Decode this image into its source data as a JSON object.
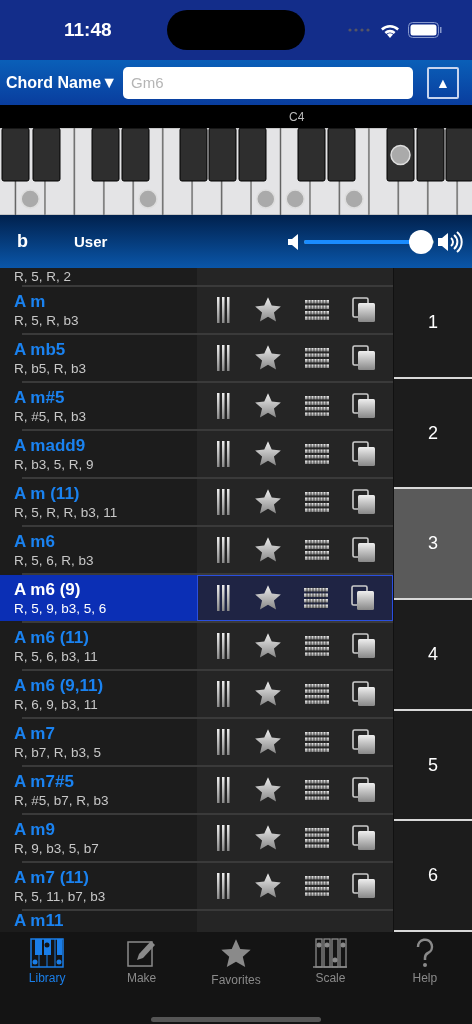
{
  "status_bar": {
    "time": "11:48"
  },
  "header": {
    "mode_button": "Chord Name▼",
    "search": {
      "placeholder": "Gm6"
    },
    "up_button": "▲"
  },
  "keyboard": {
    "octave_label": "C4",
    "white_keys": [
      {
        "marked": false
      },
      {
        "marked": true
      },
      {
        "marked": false
      },
      {
        "marked": false
      },
      {
        "marked": false
      },
      {
        "marked": true
      },
      {
        "marked": false
      },
      {
        "marked": false
      },
      {
        "marked": false
      },
      {
        "marked": true
      },
      {
        "marked": true
      },
      {
        "marked": false
      },
      {
        "marked": true
      },
      {
        "marked": false
      },
      {
        "marked": false
      },
      {
        "marked": false
      },
      {
        "marked": false
      }
    ],
    "black_keys": [
      {
        "marked": false
      },
      {
        "marked": false
      },
      {
        "marked": false
      },
      {
        "marked": false
      },
      {
        "marked": false
      },
      {
        "marked": false
      },
      {
        "marked": false
      },
      {
        "marked": false
      },
      {
        "marked": false
      },
      {
        "marked": true
      },
      {
        "marked": false
      },
      {
        "marked": false
      }
    ]
  },
  "controls": {
    "accidental": "b",
    "sound": "User",
    "volume": {
      "level": 0.9
    }
  },
  "chords": [
    {
      "notes": "R, 5, R, 2",
      "selected": false
    },
    {
      "name": "A m",
      "notes": "R, 5, R, b3",
      "selected": false
    },
    {
      "name": "A mb5",
      "notes": "R, b5, R, b3",
      "selected": false
    },
    {
      "name": "A m#5",
      "notes": "R, #5, R, b3",
      "selected": false
    },
    {
      "name": "A madd9",
      "notes": "R, b3, 5, R, 9",
      "selected": false
    },
    {
      "name": "A m (11)",
      "notes": "R, 5, R, R, b3, 11",
      "selected": false
    },
    {
      "name": "A m6",
      "notes": "R, 5, 6, R, b3",
      "selected": false
    },
    {
      "name": "A m6 (9)",
      "notes": "R, 5, 9, b3, 5, 6",
      "selected": true
    },
    {
      "name": "A m6 (11)",
      "notes": "R, 5, 6, b3, 11",
      "selected": false
    },
    {
      "name": "A m6 (9,11)",
      "notes": "R, 6, 9, b3, 11",
      "selected": false
    },
    {
      "name": "A m7",
      "notes": "R, b7, R, b3, 5",
      "selected": false
    },
    {
      "name": "A m7#5",
      "notes": "R, #5, b7, R, b3",
      "selected": false
    },
    {
      "name": "A m9",
      "notes": "R, 9, b3, 5, b7",
      "selected": false
    },
    {
      "name": "A m7 (11)",
      "notes": "R, 5, 11, b7, b3",
      "selected": false
    },
    {
      "name": "A m11",
      "selected": false
    }
  ],
  "index": [
    {
      "label": "1",
      "selected": false
    },
    {
      "label": "2",
      "selected": false
    },
    {
      "label": "3",
      "selected": true
    },
    {
      "label": "4",
      "selected": false
    },
    {
      "label": "5",
      "selected": false
    },
    {
      "label": "6",
      "selected": false
    }
  ],
  "tabs": [
    {
      "kind": "library",
      "label": "Library",
      "selected": true
    },
    {
      "kind": "make",
      "label": "Make",
      "selected": false
    },
    {
      "kind": "favorites",
      "label": "Favorites",
      "selected": false
    },
    {
      "kind": "scale",
      "label": "Scale",
      "selected": false
    },
    {
      "kind": "help",
      "label": "Help",
      "selected": false
    }
  ]
}
